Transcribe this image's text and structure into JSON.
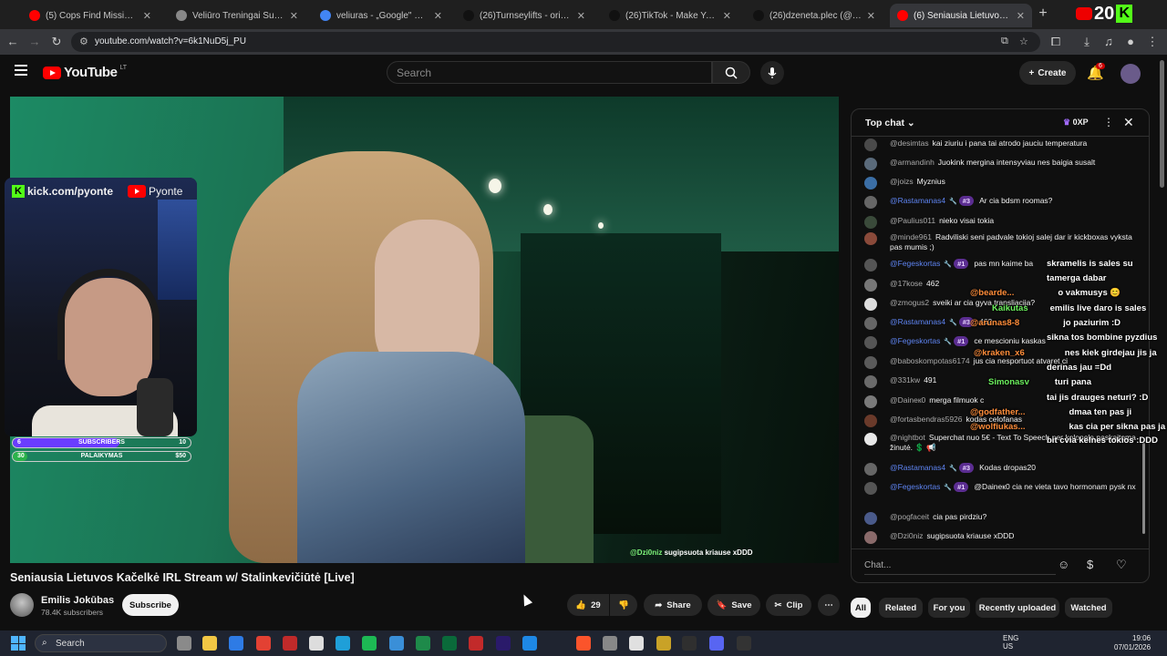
{
  "browser": {
    "tabs": [
      {
        "title": "(5) Cops Find Missing Teen's Bo",
        "favicon_color": "#ff0000",
        "active": false
      },
      {
        "title": "Veliūro Treningai Su Kapišonu -",
        "favicon_color": "#888888",
        "active": false
      },
      {
        "title": "veliuras - „Google\" paieška",
        "favicon_color": "#4285f4",
        "active": false
      },
      {
        "title": "(26)Turnseylifts - original sounc",
        "favicon_color": "#111111",
        "active": false
      },
      {
        "title": "(26)TikTok - Make Your Day",
        "favicon_color": "#111111",
        "active": false
      },
      {
        "title": "(26)dzeneta.plec (@dzeneta.pl",
        "favicon_color": "#111111",
        "active": false
      },
      {
        "title": "(6) Seniausia Lietuvos Kačelk",
        "favicon_color": "#ff0000",
        "active": true
      }
    ],
    "new_tab": "+",
    "corner_number": "20",
    "corner_kick": "K",
    "url": "youtube.com/watch?v=6k1NuD5j_PU"
  },
  "youtube": {
    "logo_text": "YouTube",
    "country": "LT",
    "search_placeholder": "Search",
    "create_label": "Create",
    "notif_count": "6"
  },
  "video": {
    "overlay_user": "@Dzi0niz",
    "overlay_text": "sugipsuota kriause xDDD",
    "kick_tag": "kick.com/pyonte",
    "yt_tag": "Pyonte",
    "goal_subs": {
      "left": "6",
      "label": "SUBSCRIBERS",
      "right": "10",
      "progress": 0.6
    },
    "goal_support": {
      "left": "30",
      "label": "PALAIKYMAS",
      "right": "$50",
      "progress": 0.06
    }
  },
  "meta": {
    "title": "Seniausia Lietuvos Kačelkė IRL Stream w/ Stalinkevičiūtė [Live]",
    "channel": "Emilis Jokūbas",
    "subscribers": "78.4K subscribers",
    "subscribe_label": "Subscribe",
    "likes": "29",
    "share_label": "Share",
    "save_label": "Save",
    "clip_label": "Clip"
  },
  "chat": {
    "header": "Top chat",
    "xp": "0XP",
    "input_placeholder": "Chat...",
    "messages": [
      {
        "user": "@desimtas",
        "text": "kai ziuriu i pana tai atrodo jauciu temperatura",
        "avatar": "#4a4a4a"
      },
      {
        "user": "@armandinh",
        "text": "Juokink mergina intensyviau nes baigia susalt",
        "avatar": "#5a6a7a"
      },
      {
        "user": "@joizs",
        "text": "Myznius",
        "avatar": "#3b6ea5"
      },
      {
        "user": "@Rastamanas4",
        "badge": "#3",
        "text": "Ar cia bdsm roomas?",
        "avatar": "#666666",
        "mod": true
      },
      {
        "user": "@Paulius011",
        "text": "nieko visai tokia",
        "avatar": "#3a4a3a"
      },
      {
        "user": "@minde961",
        "text": "Radviliski seni padvale tokioj salej dar ir kickboxas vyksta pas mumis ;)",
        "avatar": "#8a4a3a"
      },
      {
        "user": "@Fegeskortas",
        "badge": "#1",
        "text": "pas mn kaime ba",
        "avatar": "#555555",
        "mod": true
      },
      {
        "user": "@17kose",
        "text": "462",
        "avatar": "#777777"
      },
      {
        "user": "@zmogus2",
        "text": "sveiki ar cia gyva transliacija?",
        "avatar": "#dddddd"
      },
      {
        "user": "@Rastamanas4",
        "badge": "#3",
        "text": "462",
        "avatar": "#666666",
        "mod": true
      },
      {
        "user": "@Fegeskortas",
        "badge": "#1",
        "text": "ce mescioniu kaskas",
        "avatar": "#555555",
        "mod": true
      },
      {
        "user": "@baboskompotas6174",
        "text": "jus cia nesportuot atvaret ci",
        "avatar": "#5a5a5a"
      },
      {
        "user": "@331kw",
        "text": "491",
        "avatar": "#6a6a6a"
      },
      {
        "user": "@Daineк0",
        "text": "merga filmuok c",
        "avatar": "#7a7a7a"
      },
      {
        "user": "@fortasbendras5926",
        "text": "kodas celofanas",
        "avatar": "#6a3a2a"
      },
      {
        "user": "@nightbot",
        "text": "Superchat nuo 5€ - Text To Speech per kolonele paskaitoma žinutė. 💲 📢",
        "avatar": "#e8e8e8"
      },
      {
        "user": "@Rastamanas4",
        "badge": "#3",
        "text": "Kodas dropas20",
        "avatar": "#666666",
        "mod": true
      },
      {
        "user": "@Fegeskortas",
        "badge": "#1",
        "text": "@Daineк0 cia ne vieta tavo hormonam pysk nx",
        "avatar": "#555555",
        "mod": true
      },
      {
        "user": "@pogfaceit",
        "text": "cia pas pirdziu?",
        "avatar": "#4a5a8a"
      },
      {
        "user": "@Dzi0niz",
        "text": "sugipsuota kriause xDDD",
        "avatar": "#8a6a6a"
      }
    ],
    "overlay": [
      {
        "user": "",
        "text": "skramelis is sales su"
      },
      {
        "user": "",
        "text": "tamerga dabar"
      },
      {
        "user": "@bearde...",
        "text": "o vakmusys 😊",
        "platform": "yt"
      },
      {
        "user": "Kaikutas",
        "text": "emilis live daro is sales",
        "platform": "kick"
      },
      {
        "user": "@arunas8-8",
        "text": "jo paziurim :D",
        "platform": "yt"
      },
      {
        "user": "",
        "text": "sikna tos bombine pyzdius"
      },
      {
        "user": "@kraken_x6",
        "text": "nes kiek girdejau jis ja",
        "platform": "yt"
      },
      {
        "user": "",
        "text": "derinas jau =Dd"
      },
      {
        "user": "Simonasv",
        "text": "turi pana",
        "platform": "kick"
      },
      {
        "user": "",
        "text": "tai jis drauges neturi? :D"
      },
      {
        "user": "@godfather...",
        "text": "dmaa ten pas ji",
        "platform": "yt"
      },
      {
        "user": "@wolfiukas...",
        "text": "kas cia per sikna pas ja ? Ai",
        "platform": "yt"
      },
      {
        "user": "",
        "text": "bit cvia kelnes tokios :DDD"
      }
    ]
  },
  "chips": [
    "All",
    "Related",
    "For you",
    "Recently uploaded",
    "Watched"
  ],
  "taskbar": {
    "search_placeholder": "Search",
    "lang": "ENG",
    "region": "US",
    "time": "19:06",
    "date": "07/01/2026"
  }
}
